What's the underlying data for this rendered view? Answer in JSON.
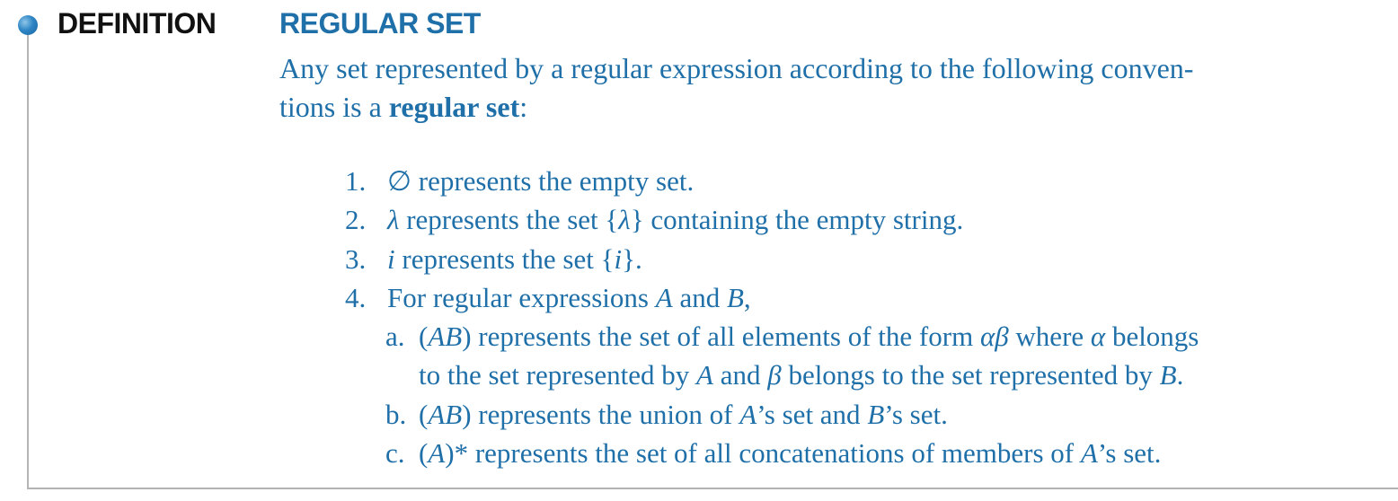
{
  "definition_label": "DEFINITION",
  "title": "REGULAR SET",
  "intro": {
    "line1": "Any set represented by a regular expression according to the following conven-",
    "line2_prefix": "tions is a ",
    "term": "regular set",
    "line2_suffix": ":"
  },
  "items": [
    {
      "num": "1.",
      "sym": "∅",
      "text": " represents the empty set."
    },
    {
      "num": "2.",
      "sym": "λ",
      "mid": " represents the set {",
      "sym2": "λ",
      "end": "} containing the empty string."
    },
    {
      "num": "3.",
      "sym": "i",
      "mid": " represents the set {",
      "sym2": "i",
      "end": "}."
    },
    {
      "num": "4.",
      "pre": "For regular expressions ",
      "a": "A",
      "and": " and ",
      "b": "B",
      "end": ","
    }
  ],
  "subitems": {
    "a": {
      "num": "a.",
      "p1": "(",
      "ab": "AB",
      "p2": ") represents the set of all elements of the form ",
      "ab_greek": "αβ",
      "p3": " where ",
      "alpha": "α",
      "p4": " belongs",
      "l2a": "to the set represented by ",
      "A": "A",
      "l2b": " and ",
      "beta": "β",
      "l2c": " belongs to the set represented by ",
      "B": "B",
      "l2d": "."
    },
    "b": {
      "num": "b.",
      "p1": "(",
      "ab": "AB",
      "p2": ") represents the union of ",
      "A": "A",
      "p3": "’s set and ",
      "B": "B",
      "p4": "’s set."
    },
    "c": {
      "num": "c.",
      "p1": "(",
      "A": "A",
      "p2": ")* represents the set of all concatenations of members of ",
      "A2": "A",
      "p3": "’s set."
    }
  }
}
